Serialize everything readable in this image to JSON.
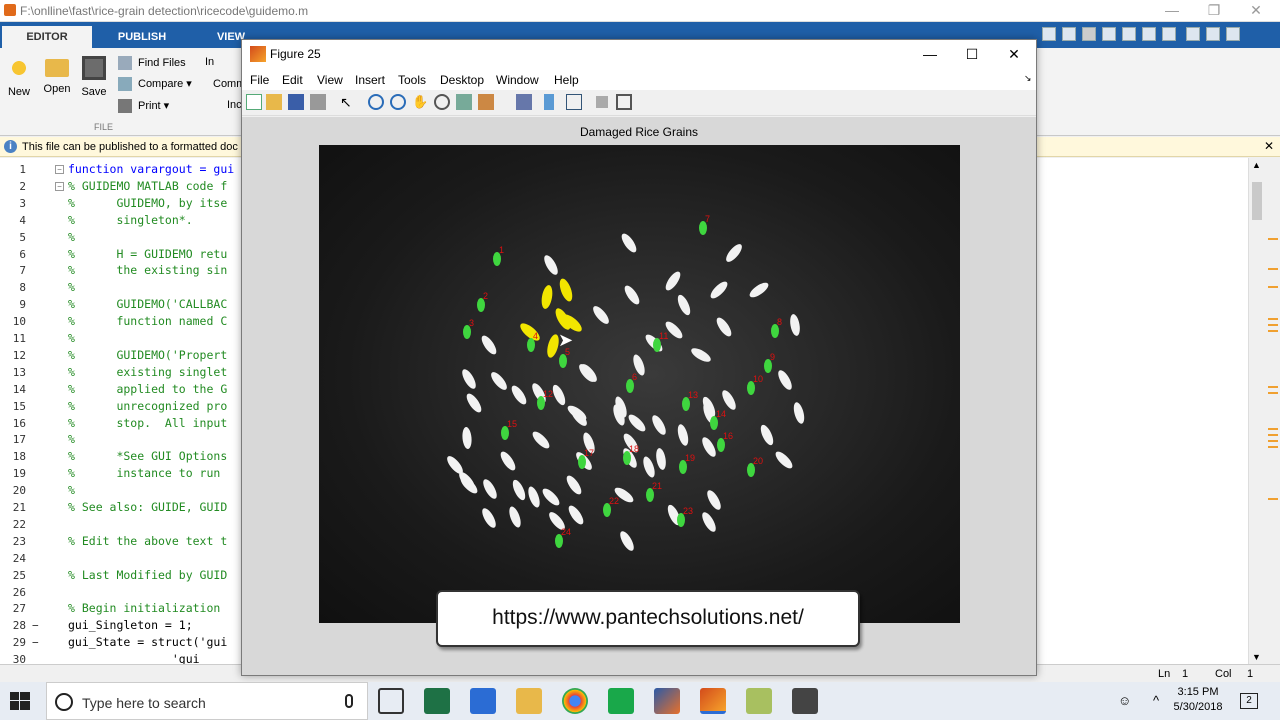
{
  "matlab": {
    "window_title": "F:\\onlline\\fast\\rice-grain detection\\ricecode\\guidemo.m",
    "tabs": [
      "EDITOR",
      "PUBLISH",
      "VIEW"
    ],
    "ribbon": {
      "new": "New",
      "open": "Open",
      "save": "Save",
      "find_files": "Find Files",
      "compare": "Compare",
      "print": "Print",
      "partial_in": "In",
      "partial_comm": "Comm",
      "partial_inc": "Inc",
      "section_file": "FILE"
    },
    "publish_notice": "This file can be published to a formatted doc",
    "code_lines": [
      {
        "n": "1",
        "text": "function varargout = gui",
        "type": "kw",
        "fold": "−"
      },
      {
        "n": "2",
        "text": "% GUIDEMO MATLAB code f",
        "type": "cm",
        "fold": "−"
      },
      {
        "n": "3",
        "text": "%      GUIDEMO, by itse",
        "type": "cm"
      },
      {
        "n": "4",
        "text": "%      singleton*.",
        "type": "cm"
      },
      {
        "n": "5",
        "text": "%",
        "type": "cm"
      },
      {
        "n": "6",
        "text": "%      H = GUIDEMO retu",
        "type": "cm"
      },
      {
        "n": "7",
        "text": "%      the existing sin",
        "type": "cm"
      },
      {
        "n": "8",
        "text": "%",
        "type": "cm"
      },
      {
        "n": "9",
        "text": "%      GUIDEMO('CALLBAC",
        "type": "cm"
      },
      {
        "n": "10",
        "text": "%      function named C",
        "type": "cm"
      },
      {
        "n": "11",
        "text": "%",
        "type": "cm"
      },
      {
        "n": "12",
        "text": "%      GUIDEMO('Propert",
        "type": "cm"
      },
      {
        "n": "13",
        "text": "%      existing singlet",
        "type": "cm"
      },
      {
        "n": "14",
        "text": "%      applied to the G",
        "type": "cm"
      },
      {
        "n": "15",
        "text": "%      unrecognized pro",
        "type": "cm"
      },
      {
        "n": "16",
        "text": "%      stop.  All input",
        "type": "cm"
      },
      {
        "n": "17",
        "text": "%",
        "type": "cm"
      },
      {
        "n": "18",
        "text": "%      *See GUI Options",
        "type": "cm"
      },
      {
        "n": "19",
        "text": "%      instance to run",
        "type": "cm"
      },
      {
        "n": "20",
        "text": "%",
        "type": "cm"
      },
      {
        "n": "21",
        "text": "% See also: GUIDE, GUID",
        "type": "cm"
      },
      {
        "n": "22",
        "text": "",
        "type": "cm"
      },
      {
        "n": "23",
        "text": "% Edit the above text t",
        "type": "cm"
      },
      {
        "n": "24",
        "text": "",
        "type": "cm"
      },
      {
        "n": "25",
        "text": "% Last Modified by GUID",
        "type": "cm"
      },
      {
        "n": "26",
        "text": "",
        "type": "cm"
      },
      {
        "n": "27",
        "text": "% Begin initialization",
        "type": "cm"
      },
      {
        "n": "28",
        "text": "gui_Singleton = 1;",
        "type": "code",
        "dash": "−"
      },
      {
        "n": "29",
        "text": "gui_State = struct('gui",
        "type": "code",
        "dash": "−"
      },
      {
        "n": "30",
        "text": "               'gui",
        "type": "code"
      }
    ],
    "status": {
      "ln_label": "Ln",
      "ln": "1",
      "col_label": "Col",
      "col": "1"
    }
  },
  "figure": {
    "title": "Figure 25",
    "menu": [
      "File",
      "Edit",
      "View",
      "Insert",
      "Tools",
      "Desktop",
      "Window",
      "Help"
    ],
    "plot_title": "Damaged Rice Grains",
    "grains": [
      {
        "state": "damaged",
        "label": "1"
      },
      {
        "state": "damaged",
        "label": "2"
      },
      {
        "state": "damaged",
        "label": "3"
      },
      {
        "state": "damaged",
        "label": "4"
      },
      {
        "state": "damaged",
        "label": "5"
      },
      {
        "state": "damaged",
        "label": "6"
      },
      {
        "state": "damaged",
        "label": "7"
      },
      {
        "state": "damaged",
        "label": "8"
      },
      {
        "state": "damaged",
        "label": "9"
      },
      {
        "state": "damaged",
        "label": "10"
      },
      {
        "state": "damaged",
        "label": "11"
      },
      {
        "state": "damaged",
        "label": "12"
      },
      {
        "state": "damaged",
        "label": "13"
      },
      {
        "state": "damaged",
        "label": "14"
      },
      {
        "state": "damaged",
        "label": "15"
      },
      {
        "state": "damaged",
        "label": "16"
      },
      {
        "state": "damaged",
        "label": "17"
      },
      {
        "state": "damaged",
        "label": "18"
      },
      {
        "state": "damaged",
        "label": "19"
      },
      {
        "state": "damaged",
        "label": "20"
      },
      {
        "state": "damaged",
        "label": "21"
      },
      {
        "state": "damaged",
        "label": "22"
      },
      {
        "state": "damaged",
        "label": "23"
      },
      {
        "state": "damaged",
        "label": "24"
      },
      {
        "state": "damaged",
        "label": "25"
      }
    ],
    "highlight_color": "#f2e600",
    "damaged_color": "#3fd63f",
    "label_color": "#e01010"
  },
  "watermark": "https://www.pantechsolutions.net/",
  "taskbar": {
    "search_placeholder": "Type here to search",
    "time": "3:15 PM",
    "date": "5/30/2018",
    "notification_count": "2"
  }
}
